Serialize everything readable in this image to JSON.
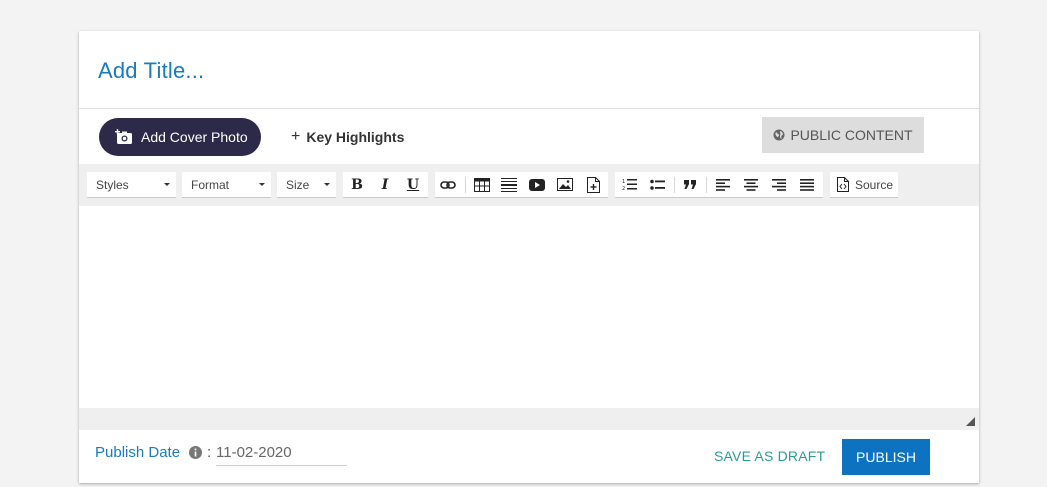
{
  "header": {
    "title_placeholder": "Add Title..."
  },
  "actions": {
    "cover_photo_label": "Add Cover Photo",
    "key_highlights_label": "Key Highlights",
    "public_content_label": "PUBLIC CONTENT"
  },
  "toolbar": {
    "styles_label": "Styles",
    "format_label": "Format",
    "size_label": "Size",
    "bold": "B",
    "italic": "I",
    "underline": "U",
    "source_label": "Source"
  },
  "footer": {
    "publish_date_label": "Publish Date",
    "colon": ":",
    "publish_date_value": "11-02-2020",
    "save_draft_label": "SAVE AS DRAFT",
    "publish_label": "PUBLISH"
  },
  "colors": {
    "accent_blue": "#1a7bbf",
    "cover_button_bg": "#2d2948",
    "publish_button_bg": "#0d72c0",
    "draft_text": "#2b9c94"
  },
  "icons": [
    "add-photo-icon",
    "plus-icon",
    "globe-icon",
    "link-icon",
    "table-icon",
    "horizontal-line-icon",
    "youtube-icon",
    "image-icon",
    "insert-file-icon",
    "numbered-list-icon",
    "bulleted-list-icon",
    "blockquote-icon",
    "align-left-icon",
    "align-center-icon",
    "align-right-icon",
    "justify-icon",
    "source-icon",
    "info-icon",
    "resize-handle-icon"
  ]
}
